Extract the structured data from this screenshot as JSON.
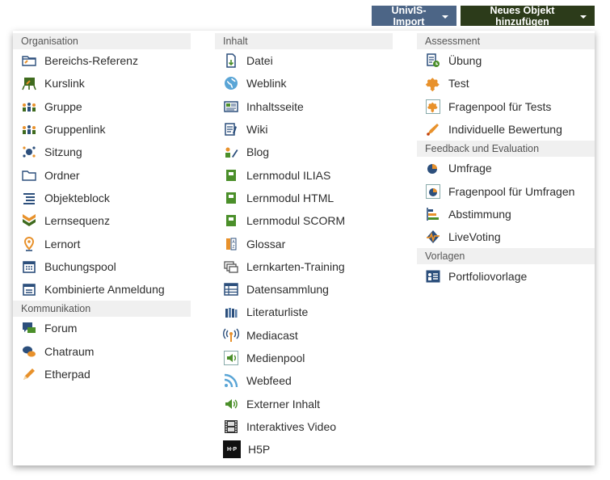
{
  "top": {
    "univis": "UnivIS-Import",
    "neu": "Neues Objekt hinzufügen"
  },
  "col1": {
    "org_header": "Organisation",
    "org": [
      "Bereichs-Referenz",
      "Kurslink",
      "Gruppe",
      "Gruppenlink",
      "Sitzung",
      "Ordner",
      "Objekteblock",
      "Lernsequenz",
      "Lernort",
      "Buchungspool",
      "Kombinierte Anmeldung"
    ],
    "kom_header": "Kommunikation",
    "kom": [
      "Forum",
      "Chatraum",
      "Etherpad"
    ]
  },
  "col2": {
    "header": "Inhalt",
    "items": [
      "Datei",
      "Weblink",
      "Inhaltsseite",
      "Wiki",
      "Blog",
      "Lernmodul ILIAS",
      "Lernmodul HTML",
      "Lernmodul SCORM",
      "Glossar",
      "Lernkarten-Training",
      "Datensammlung",
      "Literaturliste",
      "Mediacast",
      "Medienpool",
      "Webfeed",
      "Externer Inhalt",
      "Interaktives Video",
      "H5P"
    ]
  },
  "col3": {
    "ass_header": "Assessment",
    "ass": [
      "Übung",
      "Test",
      "Fragenpool für Tests",
      "Individuelle Bewertung"
    ],
    "fb_header": "Feedback und Evaluation",
    "fb": [
      "Umfrage",
      "Fragenpool für Umfragen",
      "Abstimmung",
      "LiveVoting"
    ],
    "vor_header": "Vorlagen",
    "vor": [
      "Portfoliovorlage"
    ]
  },
  "icons": {
    "h5p": "H·P"
  },
  "colors": {
    "univis": "#4c6586",
    "neu": "#2c3b1a",
    "green": "#4b8f2a",
    "orange": "#e8912b",
    "blue": "#2c4f7c"
  }
}
